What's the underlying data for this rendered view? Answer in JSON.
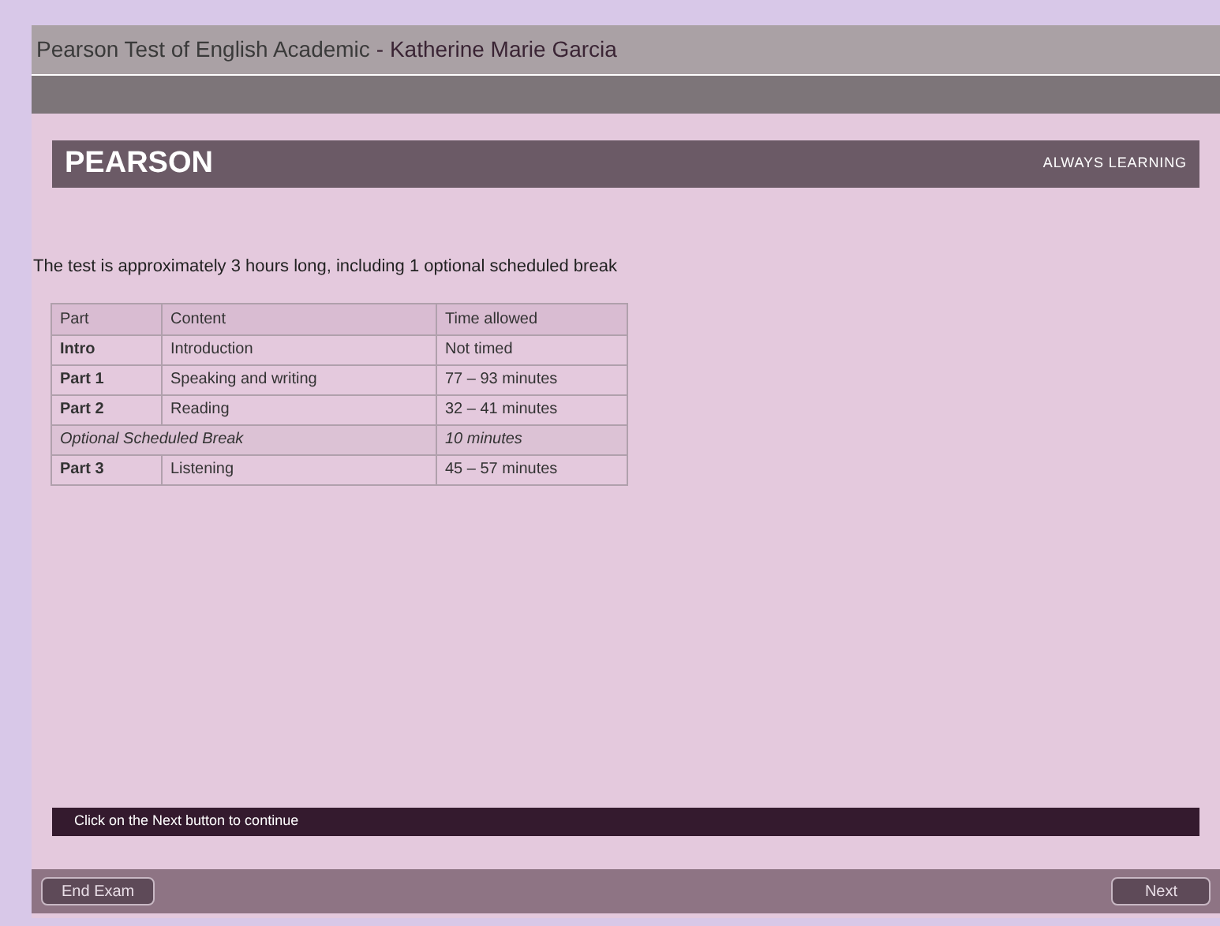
{
  "window": {
    "title": "Pearson Test of English Academic",
    "candidate": "- Katherine Marie Garcia"
  },
  "header": {
    "logo": "PEARSON",
    "tagline": "ALWAYS LEARNING"
  },
  "intro": "The test is approximately 3 hours long, including 1 optional scheduled break",
  "table": {
    "columns": [
      "Part",
      "Content",
      "Time allowed"
    ],
    "rows": [
      {
        "kind": "part",
        "cells": [
          "Intro",
          "Introduction",
          "Not timed"
        ]
      },
      {
        "kind": "part",
        "cells": [
          "Part 1",
          "Speaking and writing",
          "77 – 93 minutes"
        ]
      },
      {
        "kind": "part",
        "cells": [
          "Part 2",
          "Reading",
          "32 – 41 minutes"
        ]
      },
      {
        "kind": "break",
        "cells": [
          {
            "text": "Optional Scheduled Break",
            "colspan": 2
          },
          {
            "text": "10 minutes"
          }
        ]
      },
      {
        "kind": "part",
        "cells": [
          "Part 3",
          "Listening",
          "45 – 57 minutes"
        ]
      }
    ]
  },
  "instruction": "Click on the Next button to continue",
  "buttons": {
    "left": "End Exam",
    "right": "Next"
  }
}
